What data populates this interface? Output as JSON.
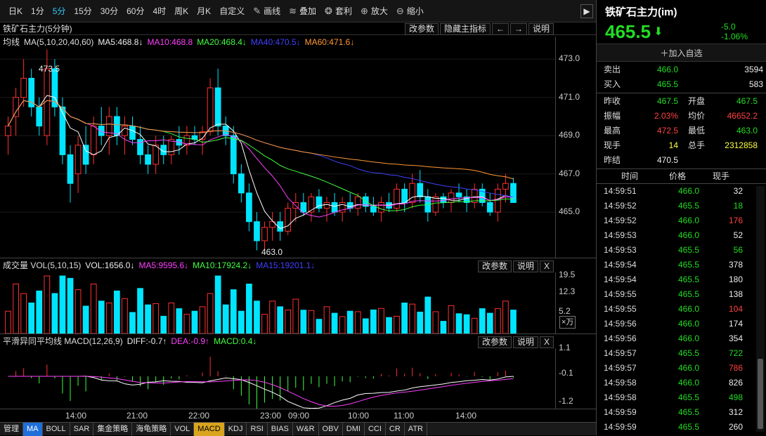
{
  "toolbar": {
    "items": [
      "日K",
      "1分",
      "5分",
      "15分",
      "30分",
      "60分",
      "4时",
      "周K",
      "月K",
      "自定义"
    ],
    "active": "5分",
    "tools": [
      {
        "icon": "pencil-icon",
        "label": "画线"
      },
      {
        "icon": "stack-icon",
        "label": "叠加"
      },
      {
        "icon": "moneybag-icon",
        "label": "套利"
      },
      {
        "icon": "zoom-in-icon",
        "label": "放大"
      },
      {
        "icon": "zoom-out-icon",
        "label": "缩小"
      }
    ]
  },
  "main": {
    "title": "铁矿石主力(5分钟)",
    "buttons": [
      "改参数",
      "隐藏主指标",
      "←",
      "→",
      "说明"
    ],
    "legend": [
      {
        "t": "均线",
        "c": "#dddddd"
      },
      {
        "t": "MA(5,10,20,40,60)",
        "c": "#dddddd"
      },
      {
        "t": "MA5:468.8↓",
        "c": "#eeeeee"
      },
      {
        "t": "MA10:468.8",
        "c": "#ff40ff"
      },
      {
        "t": "MA20:468.4↓",
        "c": "#40ff40"
      },
      {
        "t": "MA40:470.5↓",
        "c": "#4040ff"
      },
      {
        "t": "MA60:471.6↓",
        "c": "#ff9933"
      }
    ],
    "axis": [
      "473.0",
      "471.0",
      "469.0",
      "467.0",
      "465.0"
    ],
    "high_label": "473.5",
    "low_label": "463.0"
  },
  "vol": {
    "legend": [
      {
        "t": "成交量 VOL(5,10,15)",
        "c": "#dddddd"
      },
      {
        "t": "VOL:1656.0↓",
        "c": "#eeeeee"
      },
      {
        "t": "MA5:9595.6↓",
        "c": "#ff40ff"
      },
      {
        "t": "MA10:17924.2↓",
        "c": "#40ff40"
      },
      {
        "t": "MA15:19201.1↓",
        "c": "#4040ff"
      }
    ],
    "buttons": [
      "改参数",
      "说明",
      "X"
    ],
    "axis": [
      "19.5",
      "12.3",
      "5.2"
    ],
    "unit": "×万"
  },
  "macd": {
    "legend": [
      {
        "t": "平滑异同平均线 MACD(12,26,9)",
        "c": "#dddddd"
      },
      {
        "t": "DIFF:-0.7↑",
        "c": "#eeeeee"
      },
      {
        "t": "DEA:-0.9↑",
        "c": "#ff40ff"
      },
      {
        "t": "MACD:0.4↓",
        "c": "#40ff40"
      }
    ],
    "buttons": [
      "改参数",
      "说明",
      "X"
    ],
    "axis": [
      "1.1",
      "-0.1",
      "-1.2"
    ]
  },
  "time_axis": [
    "14:00",
    "21:00",
    "22:00",
    "23:00",
    "09:00",
    "10:00",
    "11:00",
    "14:00"
  ],
  "bottom": [
    "管理",
    "MA",
    "BOLL",
    "SAR",
    "集金策略",
    "海龟策略",
    "VOL",
    "MACD",
    "KDJ",
    "RSI",
    "BIAS",
    "W&R",
    "OBV",
    "DMI",
    "CCI",
    "CR",
    "ATR"
  ],
  "quote": {
    "name": "铁矿石主力(im)",
    "price": "465.5",
    "change": "-5.0",
    "pct": "-1.06%",
    "add_label": "加入自选",
    "sell": {
      "label": "卖出",
      "price": "466.0",
      "vol": "3594"
    },
    "buy": {
      "label": "买入",
      "price": "465.5",
      "vol": "583"
    },
    "stats": [
      [
        "昨收",
        "467.5",
        "开盘",
        "467.5"
      ],
      [
        "振幅",
        "2.03%",
        "均价",
        "46652.2"
      ],
      [
        "最高",
        "472.5",
        "最低",
        "463.0"
      ],
      [
        "现手",
        "14",
        "总手",
        "2312858"
      ],
      [
        "昨结",
        "470.5",
        "",
        ""
      ]
    ],
    "ticks_header": [
      "时间",
      "价格",
      "现手"
    ],
    "ticks": [
      [
        "14:59:51",
        "466.0",
        "32"
      ],
      [
        "14:59:52",
        "465.5",
        "18"
      ],
      [
        "14:59:52",
        "466.0",
        "176"
      ],
      [
        "14:59:53",
        "466.0",
        "52"
      ],
      [
        "14:59:53",
        "465.5",
        "56"
      ],
      [
        "14:59:54",
        "465.5",
        "378"
      ],
      [
        "14:59:54",
        "465.5",
        "180"
      ],
      [
        "14:59:55",
        "465.5",
        "138"
      ],
      [
        "14:59:55",
        "466.0",
        "104"
      ],
      [
        "14:59:56",
        "466.0",
        "174"
      ],
      [
        "14:59:56",
        "466.0",
        "354"
      ],
      [
        "14:59:57",
        "465.5",
        "722"
      ],
      [
        "14:59:57",
        "466.0",
        "786"
      ],
      [
        "14:59:58",
        "466.0",
        "826"
      ],
      [
        "14:59:58",
        "465.5",
        "498"
      ],
      [
        "14:59:59",
        "465.5",
        "312"
      ],
      [
        "14:59:59",
        "465.5",
        "260"
      ]
    ]
  },
  "colors": {
    "up": "#ff3030",
    "down": "#00e5ff",
    "ma5": "#ffffff",
    "ma10": "#ff40ff",
    "ma20": "#40ff40",
    "ma40": "#4040ff",
    "ma60": "#ff9933"
  },
  "chart_data": {
    "type": "candlestick",
    "ylim": [
      462.8,
      474
    ],
    "ohlc": [
      [
        469,
        470,
        468,
        469.5
      ],
      [
        470,
        471.5,
        469,
        471
      ],
      [
        471,
        473,
        470.5,
        472
      ],
      [
        472,
        472.5,
        470,
        470.5
      ],
      [
        470.5,
        471,
        469,
        469.5
      ],
      [
        469,
        473.5,
        468.5,
        472.5
      ],
      [
        472.5,
        473,
        470,
        470.5
      ],
      [
        470.5,
        471,
        467.5,
        468
      ],
      [
        468,
        468.5,
        465.5,
        466.5
      ],
      [
        467,
        469,
        466,
        468.5
      ],
      [
        468.5,
        469.5,
        467,
        467.5
      ],
      [
        468,
        470,
        467.5,
        469.5
      ],
      [
        469.5,
        470.5,
        468.5,
        469
      ],
      [
        469,
        470.5,
        468,
        470
      ],
      [
        470,
        470.5,
        468.5,
        469
      ],
      [
        469,
        470,
        468,
        469.5
      ],
      [
        469.5,
        470,
        468.5,
        468.8
      ],
      [
        468.8,
        469.5,
        467.5,
        468
      ],
      [
        468,
        468.5,
        467,
        467.5
      ],
      [
        467.5,
        469,
        467,
        468.5
      ],
      [
        468.5,
        469,
        467.5,
        468
      ],
      [
        468,
        469,
        467.5,
        468.8
      ],
      [
        468.8,
        469.5,
        468,
        468.5
      ],
      [
        468.5,
        469.5,
        468,
        469
      ],
      [
        469,
        469.5,
        468.5,
        468.8
      ],
      [
        468.8,
        469.5,
        468,
        469.2
      ],
      [
        469.2,
        472,
        469,
        471.5
      ],
      [
        471.5,
        472.5,
        469,
        469.5
      ],
      [
        469.5,
        470,
        468.5,
        469
      ],
      [
        469,
        469.5,
        466.5,
        467
      ],
      [
        467,
        467.5,
        465.5,
        466
      ],
      [
        466,
        466.5,
        464,
        464.5
      ],
      [
        464.5,
        465,
        463,
        463.5
      ],
      [
        463.5,
        464.5,
        463,
        464.2
      ],
      [
        464.2,
        465,
        463.5,
        464.5
      ],
      [
        464.5,
        465,
        463.5,
        464
      ],
      [
        464,
        465.5,
        463.8,
        465.2
      ],
      [
        465.2,
        466,
        464.5,
        465.5
      ],
      [
        465.5,
        466,
        464.8,
        465
      ],
      [
        465,
        466,
        464.5,
        465.8
      ],
      [
        465.8,
        466.2,
        465,
        465.2
      ],
      [
        465.2,
        465.8,
        464.5,
        465.5
      ],
      [
        465.5,
        466,
        464.8,
        465
      ],
      [
        465,
        465.8,
        464.5,
        465.5
      ],
      [
        465.5,
        466,
        465,
        465.2
      ],
      [
        465.2,
        466,
        464.8,
        465.8
      ],
      [
        465.8,
        466,
        465,
        465.3
      ],
      [
        465.3,
        465.8,
        464.8,
        465
      ],
      [
        465,
        465.8,
        464.5,
        465.5
      ],
      [
        465.5,
        466,
        465,
        465.2
      ],
      [
        465.2,
        466.5,
        465,
        466.2
      ],
      [
        466.2,
        466.5,
        465,
        465.5
      ],
      [
        465.5,
        467,
        465.2,
        466.5
      ],
      [
        466.5,
        467.2,
        465.5,
        465.8
      ],
      [
        465.8,
        466.2,
        464.5,
        465
      ],
      [
        465,
        466,
        464.8,
        465.8
      ],
      [
        465.8,
        466,
        465.2,
        465.5
      ],
      [
        465.5,
        466.2,
        465,
        466
      ],
      [
        466,
        466.5,
        465.5,
        465.8
      ],
      [
        465.8,
        466.2,
        465,
        465.5
      ],
      [
        465.5,
        466.5,
        465.2,
        466.2
      ],
      [
        466.2,
        466.5,
        465.3,
        465.5
      ],
      [
        465.5,
        466,
        464.8,
        465
      ],
      [
        465,
        466.5,
        464.5,
        466.2
      ],
      [
        466.2,
        467,
        465.5,
        466.5
      ],
      [
        466.5,
        466.8,
        465.5,
        465.5
      ]
    ]
  }
}
